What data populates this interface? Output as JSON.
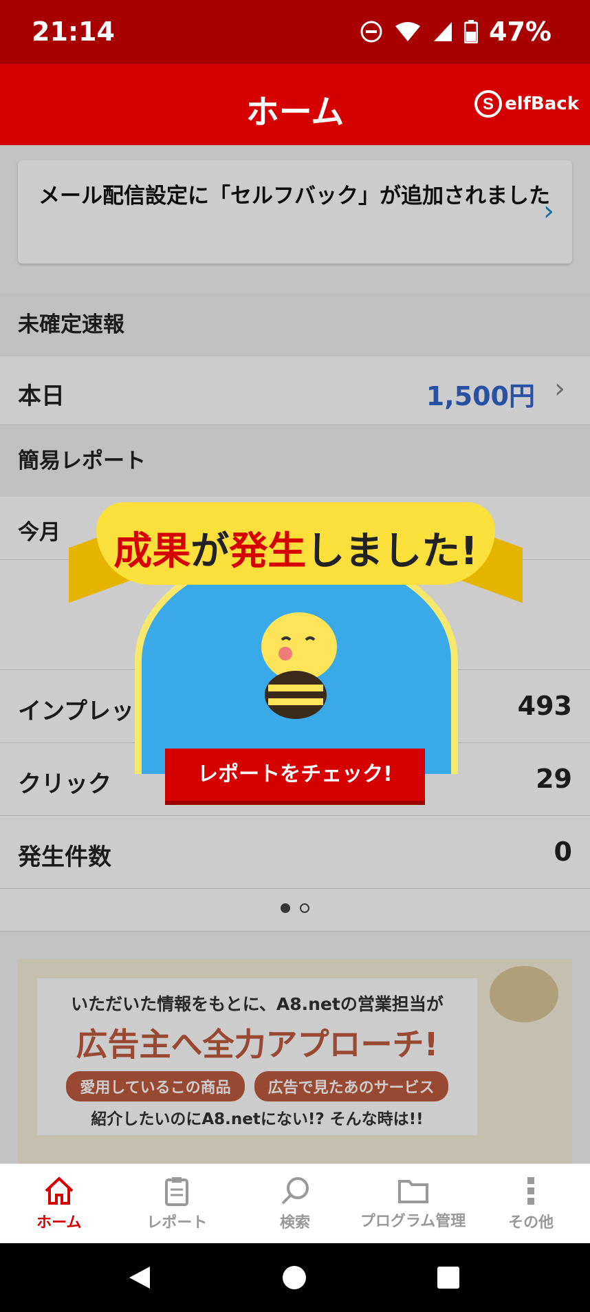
{
  "status_bar": {
    "time": "21:14",
    "battery": "47%"
  },
  "header": {
    "title": "ホーム",
    "brand": "elfBack"
  },
  "notice": {
    "text": "メール配信設定に「セルフバック」が追加されました"
  },
  "unconfirmed": {
    "heading": "未確定速報",
    "today_label": "本日",
    "today_value": "1,500円"
  },
  "simple_report": {
    "heading": "簡易レポート",
    "this_month_label": "今月",
    "rows": [
      {
        "label": "インプレッション",
        "value": "493"
      },
      {
        "label": "クリック",
        "value": "29"
      },
      {
        "label": "発生件数",
        "value": "0"
      }
    ]
  },
  "banner": {
    "line1": "いただいた情報をもとに、A8.netの営業担当が",
    "line2": "広告主へ全力アプローチ!",
    "chip1": "愛用しているこの商品",
    "chip2": "広告で見たあのサービス",
    "line3": "紹介したいのにA8.netにない!? そんな時は!!"
  },
  "popup": {
    "title_red1": "成果",
    "title_mid": "が",
    "title_red2": "発生",
    "title_end": "しました!",
    "cta": "レポートをチェック!"
  },
  "bottom_nav": [
    {
      "label": "ホーム",
      "icon": "home-icon",
      "active": true
    },
    {
      "label": "レポート",
      "icon": "clipboard-icon",
      "active": false
    },
    {
      "label": "検索",
      "icon": "search-icon",
      "active": false
    },
    {
      "label": "プログラム管理",
      "icon": "folder-icon",
      "active": false
    },
    {
      "label": "その他",
      "icon": "more-icon",
      "active": false
    }
  ],
  "colors": {
    "primary": "#d50000",
    "statusbar": "#a80000",
    "link": "#3366cc"
  }
}
